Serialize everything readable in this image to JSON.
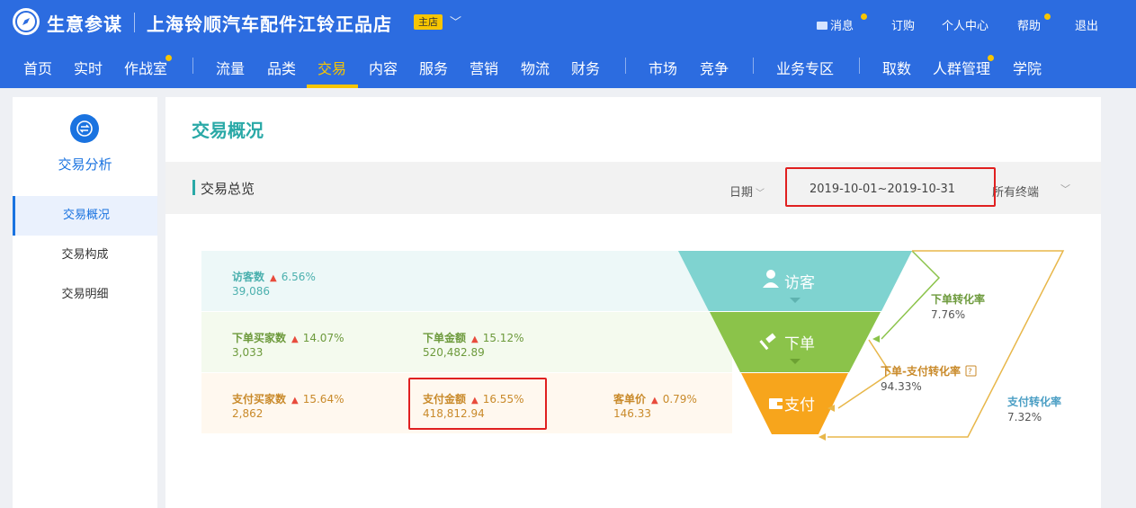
{
  "header": {
    "brand": "生意参谋",
    "shop_name": "上海铃顺汽车配件江铃正品店",
    "shop_tag": "主店",
    "links": [
      "消息",
      "订购",
      "个人中心",
      "帮助",
      "退出"
    ]
  },
  "nav": {
    "items": [
      "首页",
      "实时",
      "作战室",
      "流量",
      "品类",
      "交易",
      "内容",
      "服务",
      "营销",
      "物流",
      "财务",
      "市场",
      "竞争",
      "业务专区",
      "取数",
      "人群管理",
      "学院"
    ],
    "active": "交易"
  },
  "sidebar": {
    "title": "交易分析",
    "items": [
      "交易概况",
      "交易构成",
      "交易明细"
    ]
  },
  "main": {
    "page_title": "交易概况",
    "section_title": "交易总览",
    "date_label": "日期",
    "date_range": "2019-10-01~2019-10-31",
    "terminal_label": "所有终端"
  },
  "funnel": {
    "visitor": {
      "label": "访客数",
      "change": "6.56%",
      "value": "39,086"
    },
    "order_buyers": {
      "label": "下单买家数",
      "change": "14.07%",
      "value": "3,033"
    },
    "order_amount": {
      "label": "下单金额",
      "change": "15.12%",
      "value": "520,482.89"
    },
    "pay_buyers": {
      "label": "支付买家数",
      "change": "15.64%",
      "value": "2,862"
    },
    "pay_amount": {
      "label": "支付金额",
      "change": "16.55%",
      "value": "418,812.94"
    },
    "unit_price": {
      "label": "客单价",
      "change": "0.79%",
      "value": "146.33"
    },
    "stages": [
      "访客",
      "下单",
      "支付"
    ],
    "conversions": {
      "order_rate": {
        "label": "下单转化率",
        "value": "7.76%"
      },
      "order_pay_rate": {
        "label": "下单-支付转化率",
        "value": "94.33%"
      },
      "pay_rate": {
        "label": "支付转化率",
        "value": "7.32%"
      }
    }
  },
  "colors": {
    "header_blue": "#2c6ce0",
    "teal": "#7fd3d0",
    "green": "#8bc34a",
    "orange": "#f7a51c",
    "highlight_red": "#e02020"
  }
}
